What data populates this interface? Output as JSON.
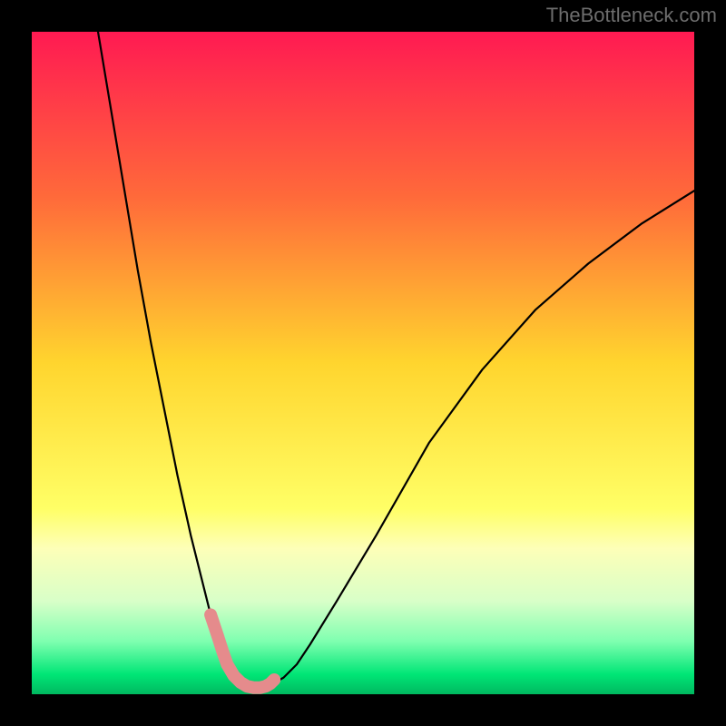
{
  "watermark": "TheBottleneck.com",
  "chart_data": {
    "type": "line",
    "title": "",
    "xlabel": "",
    "ylabel": "",
    "xlim": [
      0,
      100
    ],
    "ylim": [
      0,
      100
    ],
    "gradient_stops": [
      {
        "offset": 0,
        "color": "#ff1a52"
      },
      {
        "offset": 0.25,
        "color": "#ff6a3a"
      },
      {
        "offset": 0.5,
        "color": "#ffd52e"
      },
      {
        "offset": 0.72,
        "color": "#ffff66"
      },
      {
        "offset": 0.78,
        "color": "#fdffb8"
      },
      {
        "offset": 0.86,
        "color": "#d8ffc8"
      },
      {
        "offset": 0.92,
        "color": "#7fffb0"
      },
      {
        "offset": 0.97,
        "color": "#00e676"
      },
      {
        "offset": 1.0,
        "color": "#00b860"
      }
    ],
    "series": [
      {
        "name": "bottleneck-curve",
        "stroke": "#000000",
        "stroke_width": 2.2,
        "x": [
          10,
          12,
          14,
          16,
          18,
          20,
          22,
          24,
          26,
          27,
          28,
          29,
          30,
          31,
          32,
          33,
          34,
          36,
          38,
          40,
          42,
          46,
          52,
          60,
          68,
          76,
          84,
          92,
          100
        ],
        "values": [
          100,
          88,
          76,
          64,
          53,
          43,
          33,
          24,
          16,
          12,
          9,
          6,
          4,
          2.5,
          1.5,
          1.0,
          1.0,
          1.4,
          2.5,
          4.5,
          7.5,
          14,
          24,
          38,
          49,
          58,
          65,
          71,
          76
        ]
      },
      {
        "name": "highlight-segment",
        "stroke": "#e58b8c",
        "stroke_width": 14,
        "linecap": "round",
        "x": [
          27.0,
          28.0,
          28.8,
          29.5,
          30.5,
          31.5,
          32.5,
          33.5,
          34.5,
          35.3,
          36.0,
          36.6
        ],
        "values": [
          12.0,
          9.0,
          6.5,
          4.5,
          2.8,
          1.8,
          1.2,
          1.0,
          1.0,
          1.2,
          1.6,
          2.2
        ]
      }
    ]
  }
}
